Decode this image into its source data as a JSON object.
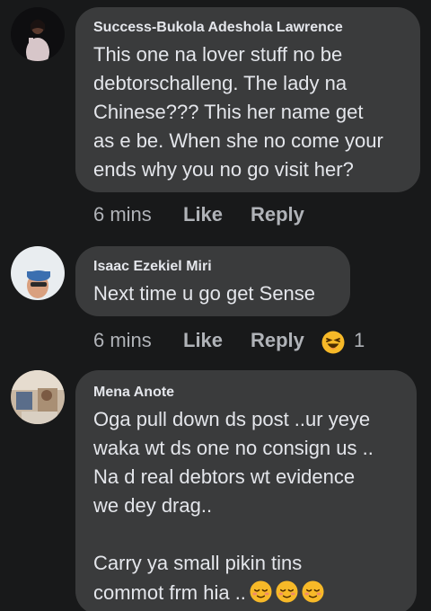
{
  "comments": [
    {
      "author": "Success-Bukola Adeshola Lawrence",
      "lines": [
        "This one na lover stuff no be",
        "debtorschalleng. The lady na",
        "Chinese??? This her name get",
        "as e be. When she no come your",
        "ends why you no go visit her?"
      ],
      "time": "6 mins",
      "like": "Like",
      "reply": "Reply"
    },
    {
      "author": "Isaac Ezekiel Miri",
      "lines": [
        "Next time u go get Sense"
      ],
      "time": "6 mins",
      "like": "Like",
      "reply": "Reply",
      "reaction": {
        "icon": "haha-reaction-icon",
        "count": "1"
      }
    },
    {
      "author": "Mena Anote",
      "lines": [
        "Oga pull down ds post ..ur yeye",
        "waka wt ds one no consign us ..",
        "Na d real debtors wt evidence",
        "we dey drag..",
        "",
        "Carry ya small pikin tins",
        "commot frm hia .."
      ],
      "trailing_emoji": [
        "relieved-face-icon",
        "relieved-face-icon",
        "relieved-face-icon"
      ]
    }
  ],
  "colors": {
    "background": "#18191a",
    "bubble": "#3a3b3c",
    "primary_text": "#e4e6eb",
    "secondary_text": "#b0b3b8",
    "emoji": "#f7b928"
  }
}
